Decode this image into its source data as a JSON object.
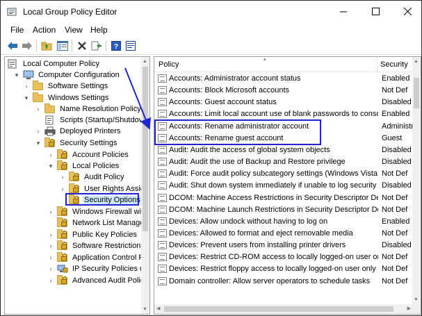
{
  "window": {
    "title": "Local Group Policy Editor",
    "buttons": {
      "minimize": "—",
      "maximize": "☐",
      "close": "✕"
    }
  },
  "menu": [
    "File",
    "Action",
    "View",
    "Help"
  ],
  "toolbar": {
    "icons": [
      "back-arrow-icon",
      "forward-arrow-icon",
      "up-folder-icon",
      "show-hide-tree-icon",
      "delete-icon",
      "export-list-icon",
      "help-icon",
      "properties-icon"
    ]
  },
  "tree": [
    {
      "label": "Local Computer Policy",
      "icon": "computer-policy-icon"
    },
    {
      "label": "Computer Configuration",
      "icon": "computer-icon",
      "chevron": "▾"
    },
    {
      "label": "Software Settings",
      "icon": "folder-icon",
      "chevron": "›"
    },
    {
      "label": "Windows Settings",
      "icon": "folder-icon",
      "chevron": "▾"
    },
    {
      "label": "Name Resolution Policy",
      "icon": "folder-icon",
      "chevron": "›"
    },
    {
      "label": "Scripts (Startup/Shutdown)",
      "icon": "scripts-icon"
    },
    {
      "label": "Deployed Printers",
      "icon": "printer-icon",
      "chevron": "›"
    },
    {
      "label": "Security Settings",
      "icon": "security-settings-icon",
      "chevron": "▾"
    },
    {
      "label": "Account Policies",
      "icon": "folder-lock-icon",
      "chevron": "›"
    },
    {
      "label": "Local Policies",
      "icon": "folder-lock-icon",
      "chevron": "▾"
    },
    {
      "label": "Audit Policy",
      "icon": "folder-lock-icon",
      "chevron": "›"
    },
    {
      "label": "User Rights Assignment",
      "icon": "folder-lock-icon",
      "chevron": "›"
    },
    {
      "label": "Security Options",
      "icon": "folder-lock-icon",
      "selected": true
    },
    {
      "label": "Windows Firewall with",
      "icon": "folder-lock-icon",
      "chevron": "›"
    },
    {
      "label": "Network List Manager",
      "icon": "folder-lock-icon"
    },
    {
      "label": "Public Key Policies",
      "icon": "folder-lock-icon",
      "chevron": "›"
    },
    {
      "label": "Software Restriction Policies",
      "icon": "folder-lock-icon",
      "chevron": "›"
    },
    {
      "label": "Application Control Policies",
      "icon": "folder-lock-icon",
      "chevron": "›"
    },
    {
      "label": "IP Security Policies on",
      "icon": "ip-security-icon",
      "chevron": "›"
    },
    {
      "label": "Advanced Audit Policy",
      "icon": "folder-lock-icon",
      "chevron": "›"
    }
  ],
  "list": {
    "columns": [
      "Policy",
      "Security"
    ],
    "sort_indicator": "▴",
    "rows": [
      {
        "policy": "Accounts: Administrator account status",
        "setting": "Enabled"
      },
      {
        "policy": "Accounts: Block Microsoft accounts",
        "setting": "Not Def"
      },
      {
        "policy": "Accounts: Guest account status",
        "setting": "Disabled"
      },
      {
        "policy": "Accounts: Limit local account use of blank passwords to console logon only",
        "setting": "Enabled"
      },
      {
        "policy": "Accounts: Rename administrator account",
        "setting": "Administrator"
      },
      {
        "policy": "Accounts: Rename guest account",
        "setting": "Guest"
      },
      {
        "policy": "Audit: Audit the access of global system objects",
        "setting": "Disabled"
      },
      {
        "policy": "Audit: Audit the use of Backup and Restore privilege",
        "setting": "Disabled"
      },
      {
        "policy": "Audit: Force audit policy subcategory settings (Windows Vista or later)",
        "setting": "Not Def"
      },
      {
        "policy": "Audit: Shut down system immediately if unable to log security audits",
        "setting": "Disabled"
      },
      {
        "policy": "DCOM: Machine Access Restrictions in Security Descriptor Definition",
        "setting": "Not Def"
      },
      {
        "policy": "DCOM: Machine Launch Restrictions in Security Descriptor Definition",
        "setting": "Not Def"
      },
      {
        "policy": "Devices: Allow undock without having to log on",
        "setting": "Enabled"
      },
      {
        "policy": "Devices: Allowed to format and eject removable media",
        "setting": "Not Def"
      },
      {
        "policy": "Devices: Prevent users from installing printer drivers",
        "setting": "Disabled"
      },
      {
        "policy": "Devices: Restrict CD-ROM access to locally logged-on user only",
        "setting": "Not Def"
      },
      {
        "policy": "Devices: Restrict floppy access to locally logged-on user only",
        "setting": "Not Def"
      },
      {
        "policy": "Domain controller: Allow server operators to schedule tasks",
        "setting": "Not Def"
      }
    ]
  },
  "colors": {
    "annotation": "#1f23d6",
    "selection": "#cce8ff",
    "folder": "#e8c15a"
  }
}
